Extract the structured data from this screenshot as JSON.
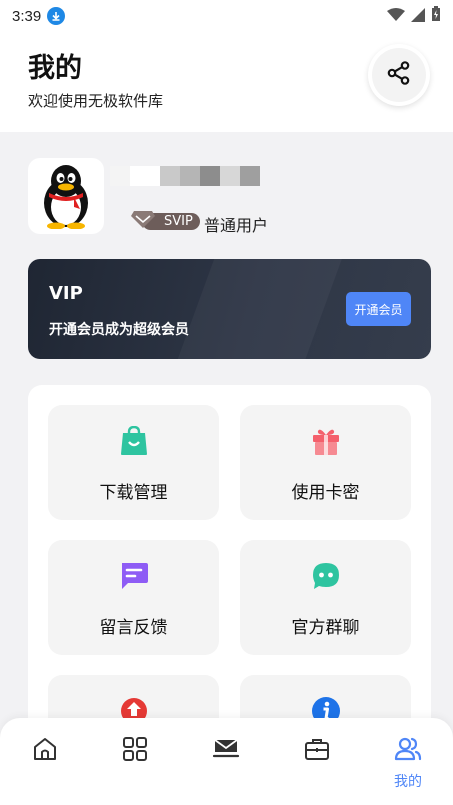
{
  "status_bar": {
    "time": "3:39"
  },
  "header": {
    "title": "我的",
    "subtitle": "欢迎使用无极软件库"
  },
  "profile": {
    "badge": "SVIP",
    "level": "普通用户"
  },
  "vip_card": {
    "title": "VIP",
    "description": "开通会员成为超级会员",
    "button": "开通会员"
  },
  "menu": {
    "items": [
      {
        "label": "下载管理",
        "icon": "shopping-bag-icon",
        "color": "#2ec4a0"
      },
      {
        "label": "使用卡密",
        "icon": "gift-icon",
        "color": "#f4606c"
      },
      {
        "label": "留言反馈",
        "icon": "message-icon",
        "color": "#8e5cf5"
      },
      {
        "label": "官方群聊",
        "icon": "chat-bubble-icon",
        "color": "#2ec4a0"
      },
      {
        "label": "",
        "icon": "upload-icon",
        "color": "#e53935"
      },
      {
        "label": "",
        "icon": "info-icon",
        "color": "#1e73e8"
      }
    ]
  },
  "bottom_nav": {
    "items": [
      {
        "icon": "home-icon"
      },
      {
        "icon": "apps-icon"
      },
      {
        "icon": "mail-icon"
      },
      {
        "icon": "briefcase-icon"
      },
      {
        "icon": "users-icon",
        "label": "我的",
        "active": true
      }
    ],
    "active_color": "#4f86f7"
  }
}
